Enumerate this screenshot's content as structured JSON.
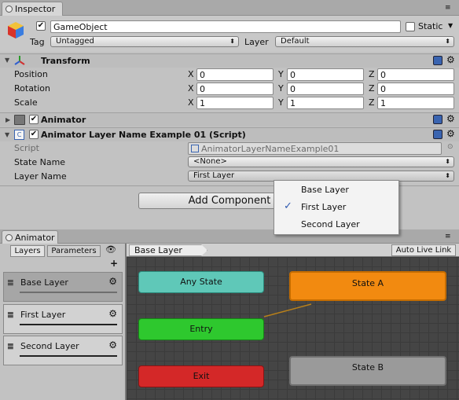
{
  "inspector": {
    "tab_label": "Inspector",
    "object_name": "GameObject",
    "static_label": "Static",
    "tag_label": "Tag",
    "tag_value": "Untagged",
    "layer_label": "Layer",
    "layer_value": "Default"
  },
  "transform": {
    "title": "Transform",
    "rows": [
      {
        "label": "Position",
        "x": "0",
        "y": "0",
        "z": "0"
      },
      {
        "label": "Rotation",
        "x": "0",
        "y": "0",
        "z": "0"
      },
      {
        "label": "Scale",
        "x": "1",
        "y": "1",
        "z": "1"
      }
    ],
    "axis_x": "X",
    "axis_y": "Y",
    "axis_z": "Z"
  },
  "animator_component": {
    "title": "Animator"
  },
  "script_component": {
    "title": "Animator Layer Name Example 01 (Script)",
    "script_label": "Script",
    "script_value": "AnimatorLayerNameExample01",
    "state_name_label": "State Name",
    "state_name_value": "<None>",
    "layer_name_label": "Layer Name",
    "layer_name_value": "First Layer"
  },
  "add_component_label": "Add Component",
  "layer_menu": {
    "items": [
      "Base Layer",
      "First Layer",
      "Second Layer"
    ],
    "checked_index": 1,
    "check_glyph": "✓"
  },
  "animator_window": {
    "tab_label": "Animator",
    "tabs": [
      "Layers",
      "Parameters"
    ],
    "add_glyph": "+",
    "layers": [
      "Base Layer",
      "First Layer",
      "Second Layer"
    ],
    "breadcrumb": "Base Layer",
    "auto_live_link": "Auto Live Link"
  },
  "graph": {
    "nodes": {
      "any_state": "Any State",
      "entry": "Entry",
      "exit": "Exit",
      "state_a": "State A",
      "state_b": "State B"
    }
  },
  "colors": {
    "any_state": "#5fc8b8",
    "entry": "#2ec82e",
    "exit": "#d42828",
    "state_a": "#f28a10",
    "state_b": "#9a9a9a",
    "graph_bg": "#454545"
  }
}
